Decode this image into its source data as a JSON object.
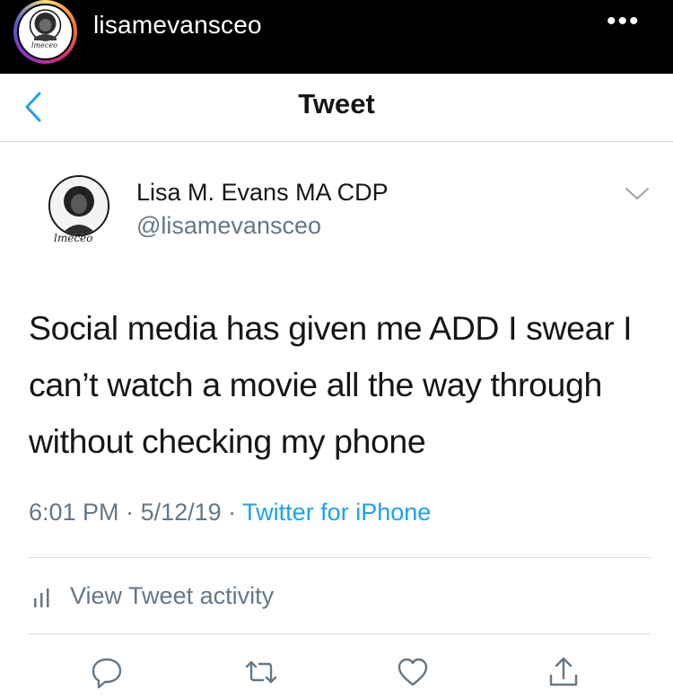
{
  "instagram": {
    "username": "lisamevansceo",
    "more_icon": "more-horizontal-icon",
    "avatar_script": "lmeceo"
  },
  "nav": {
    "back_icon": "chevron-left-icon",
    "title": "Tweet"
  },
  "tweet": {
    "author_name": "Lisa M. Evans MA CDP",
    "author_handle": "@lisamevansceo",
    "avatar_script": "lmeceo",
    "text": "Social media has given me ADD I swear I can’t watch a movie all the way through without checking my phone",
    "time": "6:01 PM",
    "date": "5/12/19",
    "separator": " · ",
    "source": "Twitter for iPhone",
    "activity_label": "View Tweet activity"
  },
  "actions": [
    "reply-icon",
    "retweet-icon",
    "like-icon",
    "share-icon"
  ],
  "colors": {
    "accent": "#1da1f2",
    "secondary_text": "#657786",
    "primary_text": "#14171a",
    "header_bg": "#000000"
  }
}
